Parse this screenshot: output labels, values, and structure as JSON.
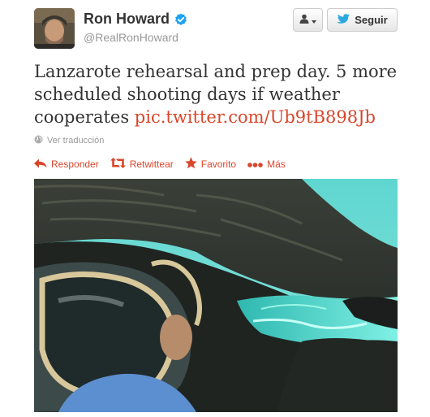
{
  "user": {
    "name": "Ron Howard",
    "handle": "@RealRonHoward"
  },
  "buttons": {
    "follow_label": "Seguir"
  },
  "tweet": {
    "text": "Lanzarote rehearsal and prep day. 5 more scheduled shooting days if weather cooperates ",
    "link": "pic.twitter.com/Ub9tB898Jb",
    "translate_label": "Ver traducción"
  },
  "actions": {
    "reply": "Responder",
    "retweet": "Retwittear",
    "favorite": "Favorito",
    "more": "Más"
  },
  "icons": {
    "verified": "verified-badge-icon",
    "user": "user-icon",
    "bird": "twitter-bird-icon",
    "globe": "globe-icon",
    "reply": "reply-arrow-icon",
    "retweet": "retweet-icon",
    "favorite": "star-icon",
    "more": "more-dots-icon"
  },
  "colors": {
    "accent": "#d9452a",
    "verified": "#1da1f2",
    "bird": "#2aa9e0",
    "muted": "#999999"
  }
}
